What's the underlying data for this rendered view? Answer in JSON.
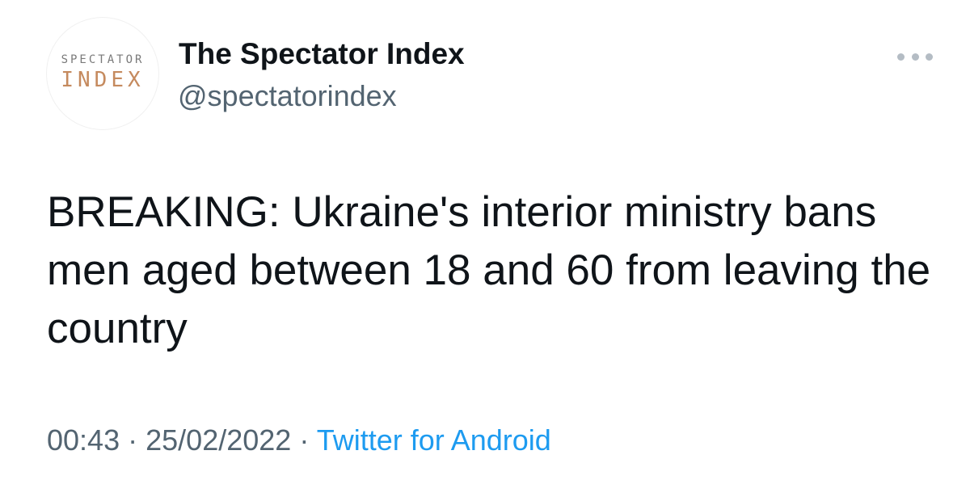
{
  "author": {
    "display_name": "The Spectator Index",
    "handle": "@spectatorindex",
    "avatar_line1": "SPECTATOR",
    "avatar_line2": "INDEX"
  },
  "menu": {
    "icon": "more-horizontal-icon"
  },
  "tweet": {
    "text": "BREAKING: Ukraine's interior ministry bans men aged between 18 and 60 from leaving the country",
    "time": "00:43",
    "separator": "·",
    "date": "25/02/2022",
    "source": "Twitter for Android"
  },
  "colors": {
    "text_primary": "#0f1419",
    "text_secondary": "#536471",
    "link": "#1d9bf0",
    "avatar_accent": "#c58a5e"
  }
}
